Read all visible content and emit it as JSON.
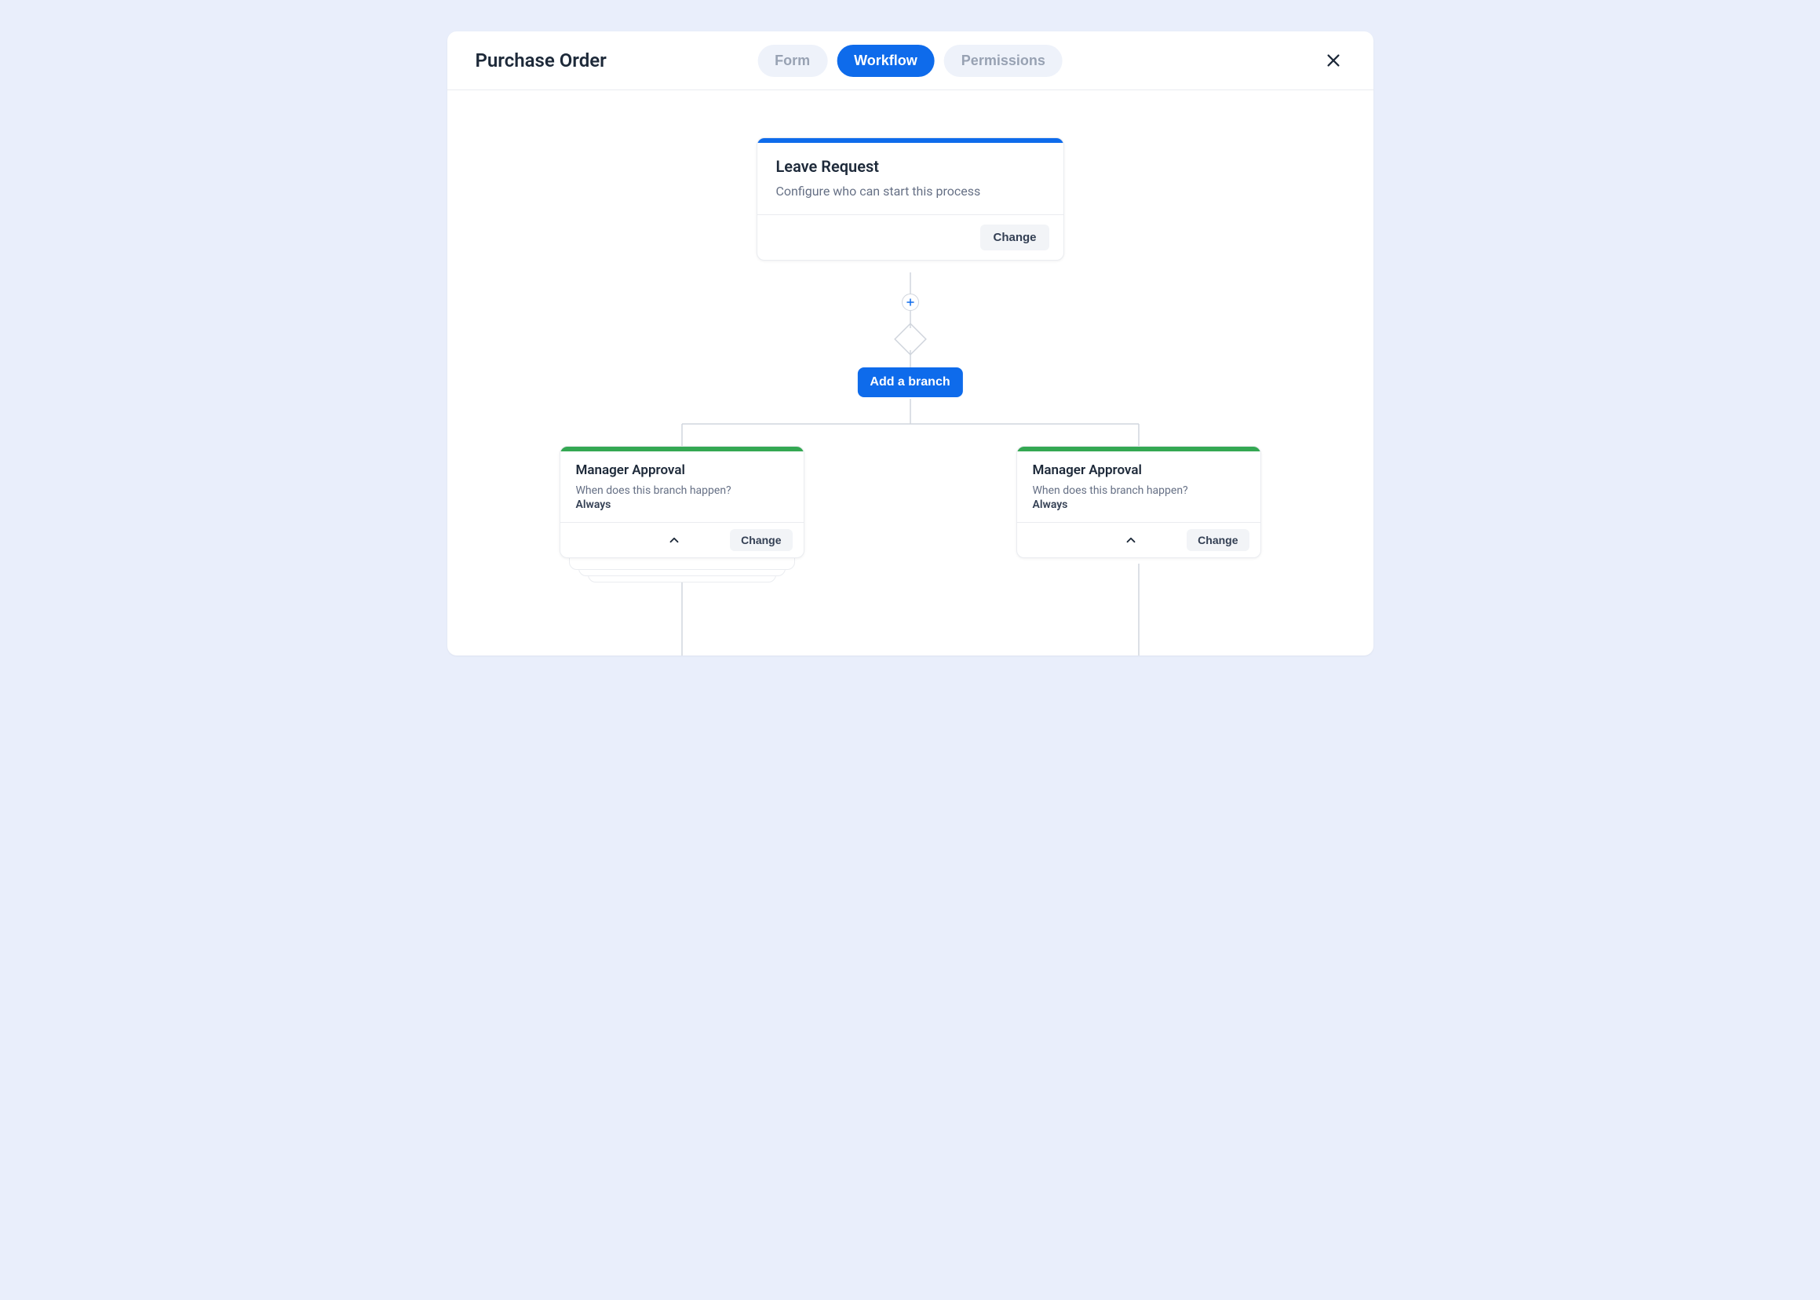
{
  "header": {
    "title": "Purchase Order",
    "tabs": {
      "form": "Form",
      "workflow": "Workflow",
      "permissions": "Permissions"
    }
  },
  "root_node": {
    "title": "Leave Request",
    "description": "Configure who can start this process",
    "change_label": "Change"
  },
  "add_branch_label": "Add a branch",
  "branches": {
    "left": {
      "title": "Manager Approval",
      "question": "When does this branch happen?",
      "answer": "Always",
      "change_label": "Change"
    },
    "right": {
      "title": "Manager Approval",
      "question": "When does this branch happen?",
      "answer": "Always",
      "change_label": "Change"
    }
  }
}
